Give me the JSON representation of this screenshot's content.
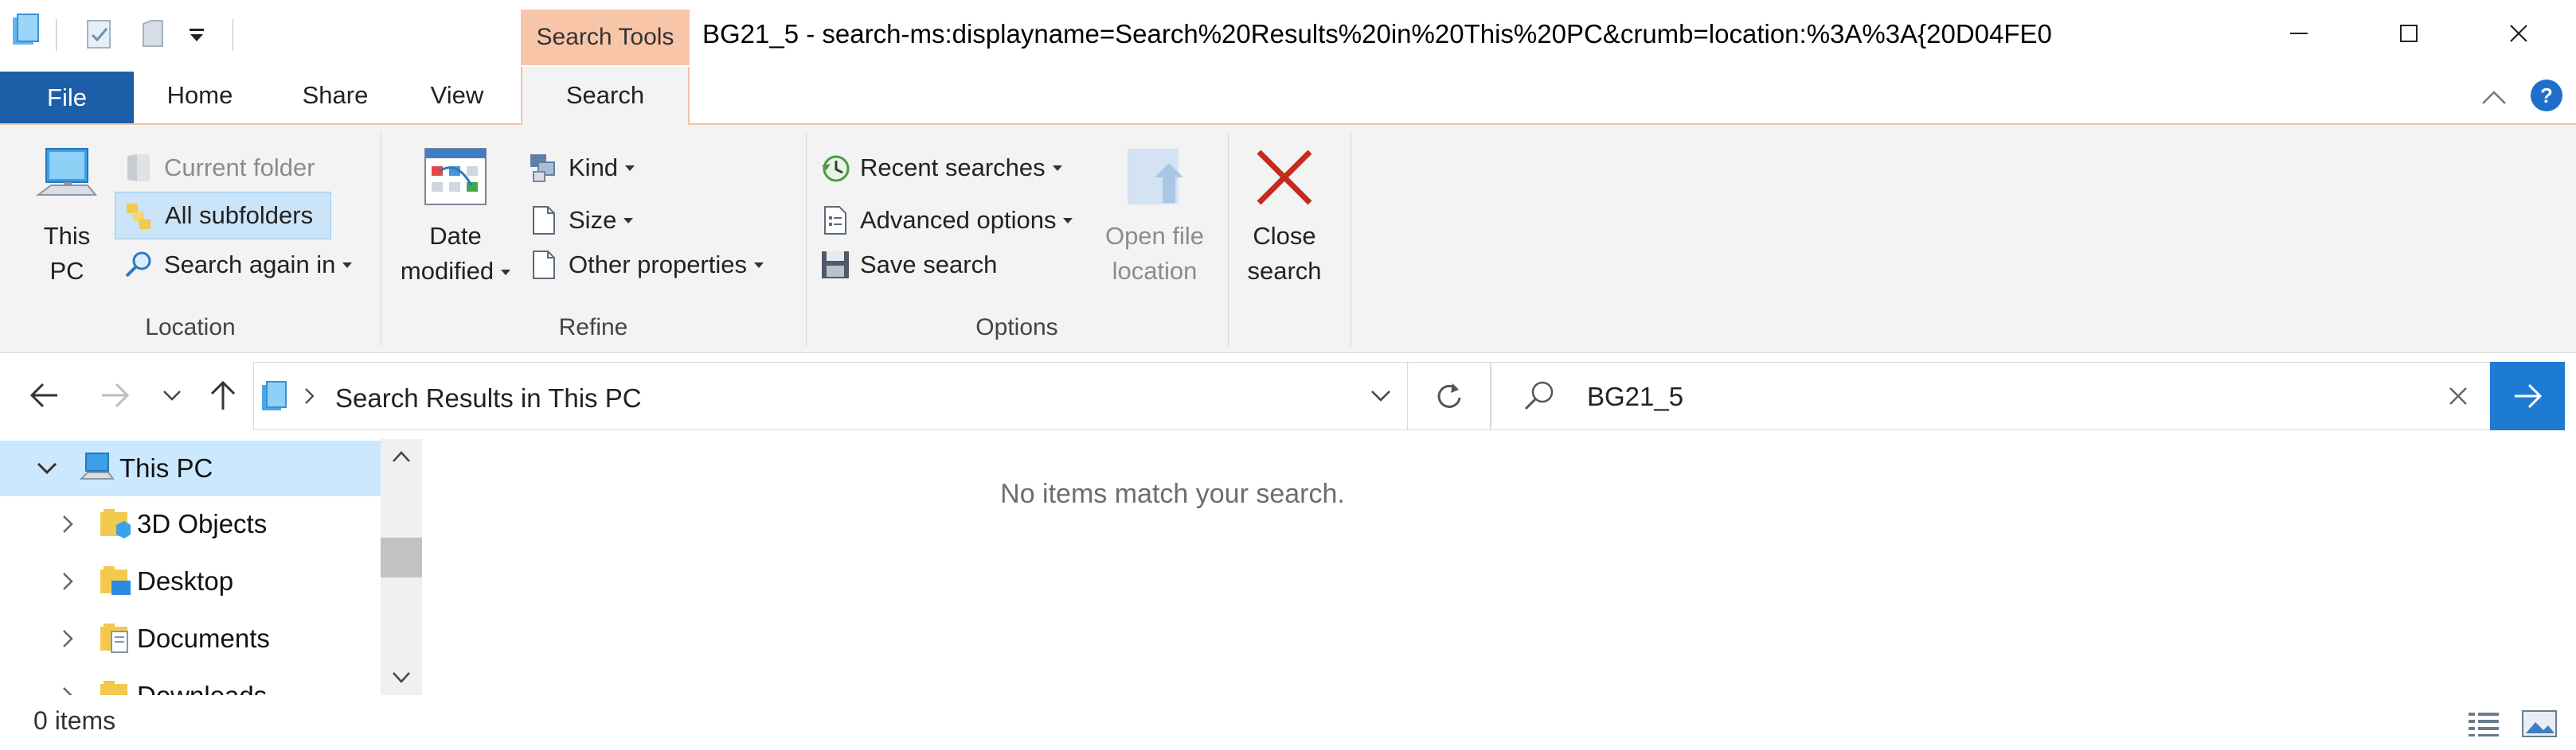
{
  "window": {
    "title": "BG21_5 - search-ms:displayname=Search%20Results%20in%20This%20PC&crumb=location:%3A%3A{20D04FE0",
    "contextual_tab_group": "Search Tools"
  },
  "tabs": [
    {
      "label": "File"
    },
    {
      "label": "Home"
    },
    {
      "label": "Share"
    },
    {
      "label": "View"
    },
    {
      "label": "Search"
    }
  ],
  "ribbon": {
    "location": {
      "label": "Location",
      "this_pc_line1": "This",
      "this_pc_line2": "PC",
      "current_folder": "Current folder",
      "all_subfolders": "All subfolders",
      "search_again_in": "Search again in"
    },
    "refine": {
      "label": "Refine",
      "date_line1": "Date",
      "date_line2": "modified",
      "kind": "Kind",
      "size": "Size",
      "other_properties": "Other properties"
    },
    "options": {
      "label": "Options",
      "recent_searches": "Recent searches",
      "advanced_options": "Advanced options",
      "save_search": "Save search",
      "open_file_line1": "Open file",
      "open_file_line2": "location"
    },
    "close": {
      "line1": "Close",
      "line2": "search"
    }
  },
  "address_bar": {
    "path": "Search Results in This PC"
  },
  "search": {
    "value": "BG21_5"
  },
  "nav_tree": [
    {
      "label": "This PC"
    },
    {
      "label": "3D Objects"
    },
    {
      "label": "Desktop"
    },
    {
      "label": "Documents"
    },
    {
      "label": "Downloads"
    }
  ],
  "content": {
    "empty_message": "No items match your search."
  },
  "status": {
    "item_count": "0 items"
  },
  "colors": {
    "accent": "#1e7bd4",
    "file_tab": "#1d5fa8",
    "search_tools": "#f9c5a9",
    "selection": "#cce8ff",
    "close_red": "#c42b1c"
  }
}
